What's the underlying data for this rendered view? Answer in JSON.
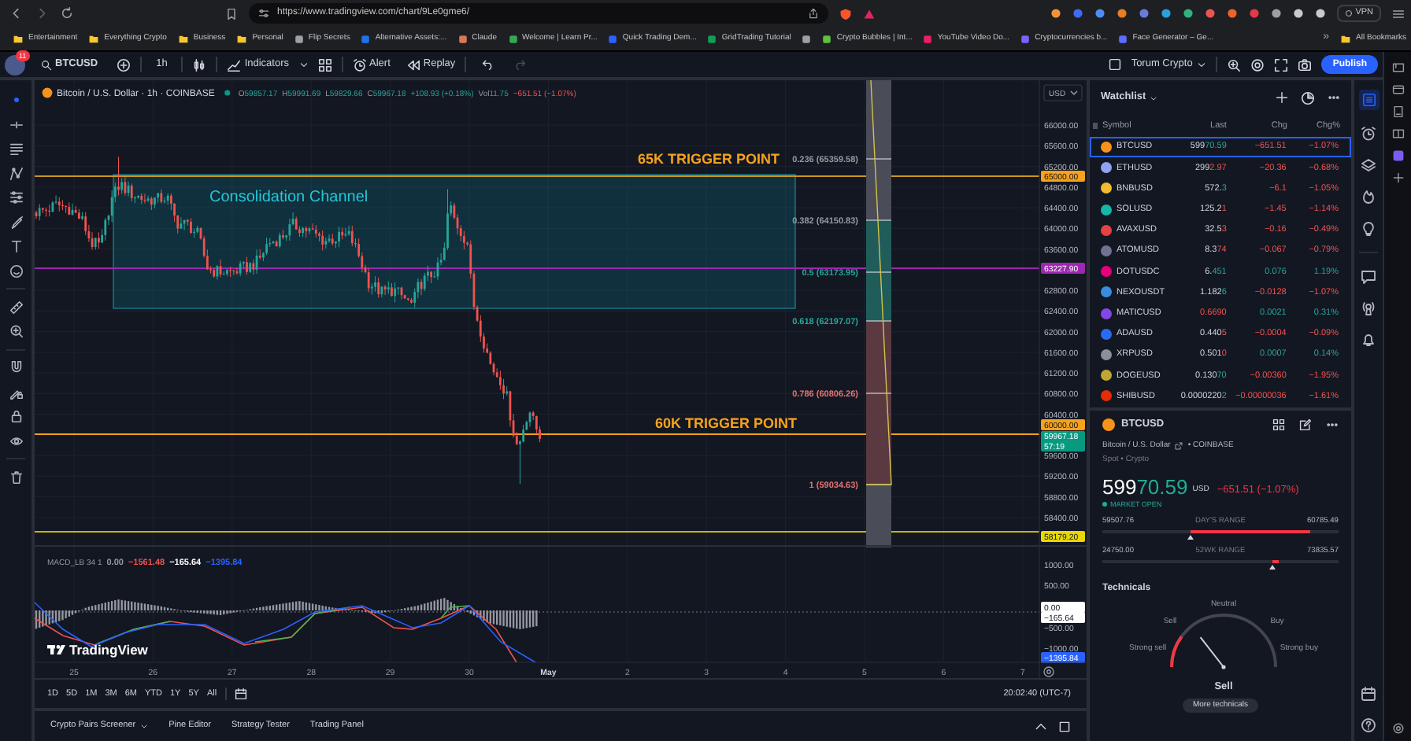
{
  "browser": {
    "url": "https://www.tradingview.com/chart/9Le0gme6/",
    "vpn": "VPN",
    "bookmarks": [
      {
        "label": "Entertainment",
        "kind": "folder"
      },
      {
        "label": "Everything Crypto",
        "kind": "folder"
      },
      {
        "label": "Business",
        "kind": "folder"
      },
      {
        "label": "Personal",
        "kind": "folder"
      },
      {
        "label": "Flip Secrets",
        "kind": "site",
        "color": "#9aa0a6"
      },
      {
        "label": "Alternative Assets:...",
        "kind": "site",
        "color": "#1a73e8"
      },
      {
        "label": "Claude",
        "kind": "site",
        "color": "#d97757"
      },
      {
        "label": "Welcome | Learn Pr...",
        "kind": "site",
        "color": "#34a853"
      },
      {
        "label": "Quick Trading Dem...",
        "kind": "site",
        "color": "#2962ff"
      },
      {
        "label": "GridTrading Tutorial",
        "kind": "site",
        "color": "#0f9d58"
      },
      {
        "kind": "site",
        "color": "#9aa0a6"
      },
      {
        "label": "Crypto Bubbles | Int...",
        "kind": "site",
        "color": "#5fbf3f"
      },
      {
        "label": "YouTube Video Do...",
        "kind": "site",
        "color": "#e91e63"
      },
      {
        "label": "Cryptocurrencies b...",
        "kind": "site",
        "color": "#7b61ff"
      },
      {
        "label": "Face Generator – Ge...",
        "kind": "site",
        "color": "#5b6cff"
      }
    ],
    "more": "»",
    "all_bookmarks": "All Bookmarks"
  },
  "toolbar": {
    "notification_count": "11",
    "symbol": "BTCUSD",
    "interval": "1h",
    "indicators": "Indicators",
    "alert": "Alert",
    "replay": "Replay",
    "layout_name": "Torum Crypto",
    "publish": "Publish"
  },
  "chart": {
    "legend": {
      "title": "Bitcoin / U.S. Dollar · 1h · COINBASE",
      "values": [
        {
          "label": "O",
          "value": "59857.17",
          "negative": false
        },
        {
          "label": "H",
          "value": "59991.69",
          "negative": false
        },
        {
          "label": "L",
          "value": "59829.66",
          "negative": false
        },
        {
          "label": "C",
          "value": "59967.18",
          "negative": false
        },
        {
          "value": "+108.93 (+0.18%)",
          "negative": false
        },
        {
          "label": "Vol",
          "value": "11.75",
          "negative": false
        },
        {
          "value": "−651.51 (−1.07%)",
          "negative": true
        }
      ]
    },
    "currency": "USD",
    "price_axis": [
      "66000.00",
      "65600.00",
      "65200.00",
      "64800.00",
      "64400.00",
      "64000.00",
      "63600.00",
      "62800.00",
      "62400.00",
      "62000.00",
      "61600.00",
      "61200.00",
      "60800.00",
      "60400.00",
      "59600.00",
      "59200.00",
      "58800.00",
      "58400.00"
    ],
    "price_tags": [
      {
        "text": "65000.00",
        "color": "#f7a21b"
      },
      {
        "text": "63227.90",
        "color": "#9c27b0"
      },
      {
        "text": "60000.00",
        "color": "#f7a21b"
      },
      {
        "text": "59967.18",
        "subtext": "57:19",
        "color": "#089981"
      },
      {
        "text": "58179.20",
        "color": "#e8d800"
      }
    ],
    "channel_label": "Consolidation Channel",
    "trigger_labels": [
      "65K TRIGGER POINT",
      "60K TRIGGER POINT"
    ],
    "fib_levels": [
      {
        "label": "0.236 (65359.58)",
        "color": "#9598a1"
      },
      {
        "label": "0.382 (64150.83)",
        "color": "#9598a1"
      },
      {
        "label": "0.5 (63173.95)",
        "color": "#26a69a"
      },
      {
        "label": "0.618 (62197.07)",
        "color": "#26a69a"
      },
      {
        "label": "0.786 (60806.26)",
        "color": "#e57373"
      },
      {
        "label": "1 (59034.63)",
        "color": "#e57373"
      }
    ],
    "macd": {
      "title": "MACD_LB 34 1",
      "values": [
        {
          "text": "0.00",
          "color": "#9598a1"
        },
        {
          "text": "−1561.48",
          "color": "#ef5350"
        },
        {
          "text": "−165.64",
          "color": "#ffffff"
        },
        {
          "text": "−1395.84",
          "color": "#2962ff"
        }
      ],
      "axis": [
        "1000.00",
        "500.00",
        "−500.00",
        "−1000.00"
      ],
      "tags": [
        {
          "text": "0.00",
          "color": "#ffffff"
        },
        {
          "text": "−165.64",
          "color": "#ffffff"
        },
        {
          "text": "−1395.84",
          "color": "#2962ff"
        }
      ]
    },
    "branding": "TradingView",
    "time_axis": [
      {
        "label": "25",
        "kind": "day"
      },
      {
        "label": "26",
        "kind": "day"
      },
      {
        "label": "27",
        "kind": "day"
      },
      {
        "label": "28",
        "kind": "day"
      },
      {
        "label": "29",
        "kind": "day"
      },
      {
        "label": "30",
        "kind": "day"
      },
      {
        "label": "May",
        "kind": "month"
      },
      {
        "label": "2",
        "kind": "day"
      },
      {
        "label": "3",
        "kind": "day"
      },
      {
        "label": "4",
        "kind": "day"
      },
      {
        "label": "5",
        "kind": "day"
      },
      {
        "label": "6",
        "kind": "day"
      },
      {
        "label": "7",
        "kind": "day"
      }
    ],
    "ranges": [
      "1D",
      "5D",
      "1M",
      "3M",
      "6M",
      "YTD",
      "1Y",
      "5Y",
      "All"
    ],
    "clock": "20:02:40 (UTC-7)"
  },
  "bottom_tabs": [
    {
      "label": "Crypto Pairs Screener",
      "dropdown": true
    },
    {
      "label": "Pine Editor",
      "dropdown": false
    },
    {
      "label": "Strategy Tester",
      "dropdown": false
    },
    {
      "label": "Trading Panel",
      "dropdown": false
    }
  ],
  "watchlist": {
    "title": "Watchlist",
    "columns": [
      "Symbol",
      "Last",
      "Chg",
      "Chg%"
    ],
    "rows": [
      {
        "symbol": "BTCUSD",
        "color": "#f7931a",
        "last_base": "599",
        "last_tick": "70.59",
        "tick_down": false,
        "change": "−651.51",
        "change_pct": "−1.07%",
        "negative": true,
        "selected": true
      },
      {
        "symbol": "ETHUSD",
        "color": "#8fa3f0",
        "last_base": "299",
        "last_tick": "2.97",
        "tick_down": true,
        "change": "−20.36",
        "change_pct": "−0.68%",
        "negative": true,
        "selected": false
      },
      {
        "symbol": "BNBUSD",
        "color": "#f3ba2f",
        "last_base": "572.",
        "last_tick": "3",
        "tick_down": false,
        "change": "−6.1",
        "change_pct": "−1.05%",
        "negative": true,
        "selected": false
      },
      {
        "symbol": "SOLUSD",
        "color": "#14b8a6",
        "last_base": "125.2",
        "last_tick": "1",
        "tick_down": true,
        "change": "−1.45",
        "change_pct": "−1.14%",
        "negative": true,
        "selected": false
      },
      {
        "symbol": "AVAXUSD",
        "color": "#e84142",
        "last_base": "32.5",
        "last_tick": "3",
        "tick_down": true,
        "change": "−0.16",
        "change_pct": "−0.49%",
        "negative": true,
        "selected": false
      },
      {
        "symbol": "ATOMUSD",
        "color": "#6f7390",
        "last_base": "8.3",
        "last_tick": "74",
        "tick_down": true,
        "change": "−0.067",
        "change_pct": "−0.79%",
        "negative": true,
        "selected": false
      },
      {
        "symbol": "DOTUSDC",
        "color": "#e6007a",
        "last_base": "6.",
        "last_tick": "451",
        "tick_down": false,
        "change": "0.076",
        "change_pct": "1.19%",
        "negative": false,
        "selected": false
      },
      {
        "symbol": "NEXOUSDT",
        "color": "#3a8dde",
        "last_base": "1.182",
        "last_tick": "6",
        "tick_down": false,
        "change": "−0.0128",
        "change_pct": "−1.07%",
        "negative": true,
        "selected": false
      },
      {
        "symbol": "MATICUSD",
        "color": "#8247e5",
        "last_tick": "0.6690",
        "tick_down": true,
        "change": "0.0021",
        "change_pct": "0.31%",
        "negative": false,
        "selected": false
      },
      {
        "symbol": "ADAUSD",
        "color": "#2a6cf0",
        "last_base": "0.440",
        "last_tick": "5",
        "tick_down": true,
        "change": "−0.0004",
        "change_pct": "−0.09%",
        "negative": true,
        "selected": false
      },
      {
        "symbol": "XRPUSD",
        "color": "#8a8f98",
        "last_base": "0.501",
        "last_tick": "0",
        "tick_down": true,
        "change": "0.0007",
        "change_pct": "0.14%",
        "negative": false,
        "selected": false
      },
      {
        "symbol": "DOGEUSD",
        "color": "#c2a633",
        "last_base": "0.130",
        "last_tick": "70",
        "tick_down": false,
        "change": "−0.00360",
        "change_pct": "−1.95%",
        "negative": true,
        "selected": false
      },
      {
        "symbol": "SHIBUSD",
        "color": "#e42d04",
        "last_base": "0.0000220",
        "last_tick": "2",
        "tick_down": false,
        "change": "−0.00000036",
        "change_pct": "−1.61%",
        "negative": true,
        "selected": false
      }
    ]
  },
  "details": {
    "symbol": "BTCUSD",
    "name": "Bitcoin / U.S. Dollar",
    "exchange": "• COINBASE",
    "market_type": "Spot • Crypto",
    "price_base": "599",
    "price_tick": "70.59",
    "currency": "USD",
    "change": "−651.51 (−1.07%)",
    "status": "MARKET OPEN",
    "days_range": {
      "low": "59507.76",
      "label": "DAY'S RANGE",
      "high": "60785.49",
      "level": 0.37
    },
    "year_range": {
      "low": "24750.00",
      "label": "52WK RANGE",
      "high": "73835.57",
      "level": 0.72
    }
  },
  "technicals": {
    "title": "Technicals",
    "scale": [
      "Strong sell",
      "Sell",
      "Neutral",
      "Buy",
      "Strong buy"
    ],
    "result": "Sell",
    "button": "More technicals"
  }
}
